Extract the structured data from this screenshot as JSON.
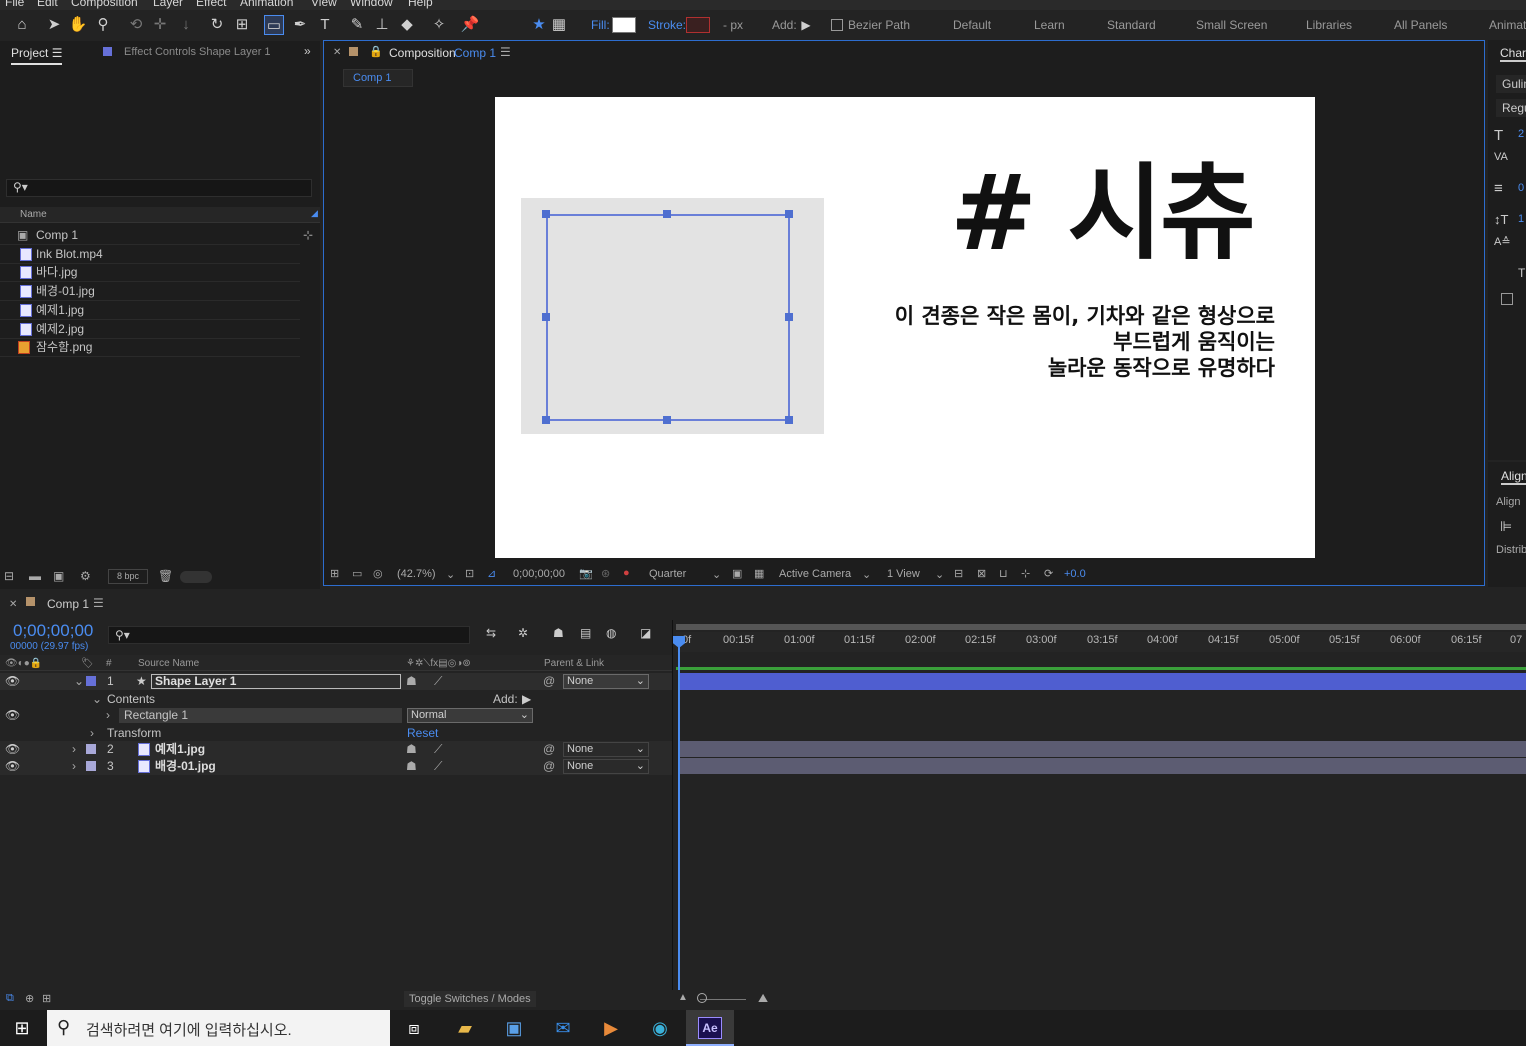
{
  "menu": [
    "File",
    "Edit",
    "Composition",
    "Layer",
    "Effect",
    "Animation",
    "View",
    "Window",
    "Help"
  ],
  "toolbar": {
    "fill_label": "Fill:",
    "stroke_label": "Stroke:",
    "stroke_px": "- px",
    "add_label": "Add:",
    "bezier_label": "Bezier Path",
    "workspaces": [
      "Default",
      "Learn",
      "Standard",
      "Small Screen",
      "Libraries",
      "All Panels",
      "Animat"
    ]
  },
  "project": {
    "tab": "Project",
    "effect_tab": "Effect Controls Shape Layer 1",
    "col_name": "Name",
    "items": [
      "Comp 1",
      "Ink Blot.mp4",
      "바다.jpg",
      "배경-01.jpg",
      "예제1.jpg",
      "예제2.jpg",
      "잠수함.png"
    ],
    "bpc": "8 bpc"
  },
  "comp": {
    "tab_label": "Composition",
    "tab_name": "Comp 1",
    "flow_tab": "Comp 1",
    "zoom": "(42.7%)",
    "timecode": "0;00;00;00",
    "resolution": "Quarter",
    "camera": "Active Camera",
    "views": "1 View",
    "exposure": "+0.0"
  },
  "canvas": {
    "title": "# 시츄",
    "line1": "이 견종은 작은 몸이, 기차와 같은 형상으로",
    "line2": "부드럽게 움직이는",
    "line3": "놀라운 동작으로 유명하다"
  },
  "right": {
    "char_tab": "Char",
    "font": "Gulin",
    "style": "Regu",
    "align_tab": "Align",
    "align_label": "Align",
    "distrib": "Distrib",
    "v1": "2",
    "v2": "0",
    "v3": "1"
  },
  "timeline": {
    "tab": "Comp 1",
    "timecode": "0;00;00;00",
    "fps": "00000 (29.97 fps)",
    "col_source": "Source Name",
    "col_parent": "Parent & Link",
    "contents": "Contents",
    "add": "Add:",
    "rect": "Rectangle 1",
    "mode": "Normal",
    "transform": "Transform",
    "reset": "Reset",
    "toggle": "Toggle Switches / Modes",
    "layers": [
      {
        "num": "1",
        "name": "Shape Layer 1",
        "parent": "None"
      },
      {
        "num": "2",
        "name": "예제1.jpg",
        "parent": "None"
      },
      {
        "num": "3",
        "name": "배경-01.jpg",
        "parent": "None"
      }
    ],
    "ruler": [
      "0f",
      "00:15f",
      "01:00f",
      "01:15f",
      "02:00f",
      "02:15f",
      "03:00f",
      "03:15f",
      "04:00f",
      "04:15f",
      "05:00f",
      "05:15f",
      "06:00f",
      "06:15f",
      "07"
    ]
  },
  "taskbar": {
    "search_placeholder": "검색하려면 여기에 입력하십시오.",
    "ae": "Ae"
  }
}
